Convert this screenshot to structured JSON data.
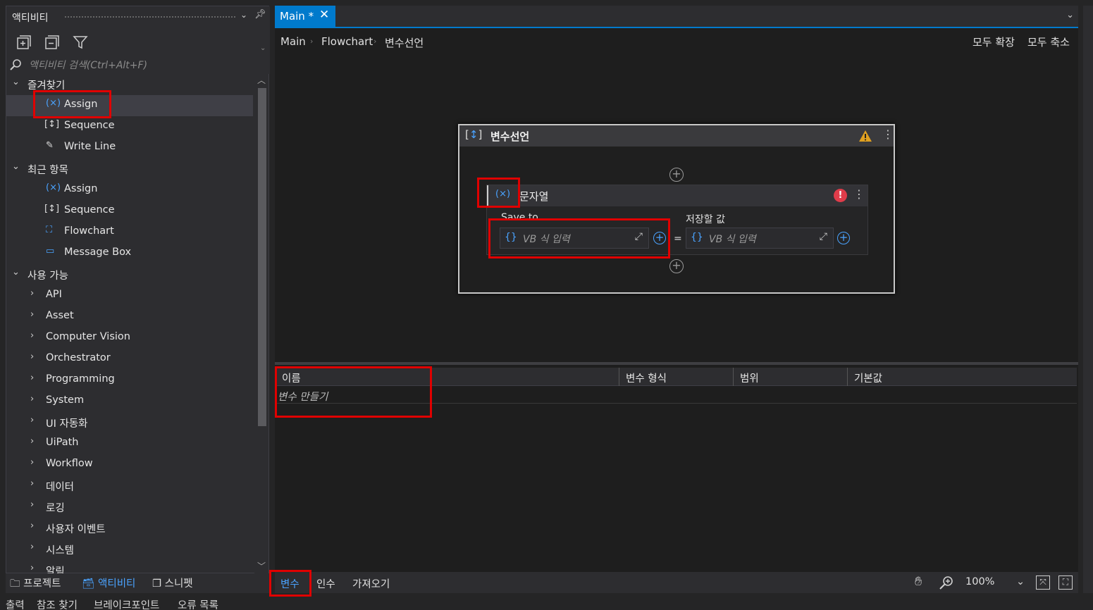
{
  "activities_panel": {
    "title": "액티비티",
    "search_placeholder": "액티비티 검색(Ctrl+Alt+F)",
    "favorites": {
      "label": "즐겨찾기",
      "items": [
        {
          "label": "Assign",
          "icon": "(×)"
        },
        {
          "label": "Sequence",
          "icon": "[↕]"
        },
        {
          "label": "Write Line",
          "icon": "✎"
        }
      ]
    },
    "recent": {
      "label": "최근 항목",
      "items": [
        {
          "label": "Assign",
          "icon": "(×)"
        },
        {
          "label": "Sequence",
          "icon": "[↕]"
        },
        {
          "label": "Flowchart",
          "icon": "⛶"
        },
        {
          "label": "Message Box",
          "icon": "▭"
        }
      ]
    },
    "available": {
      "label": "사용 가능",
      "items": [
        "API",
        "Asset",
        "Computer Vision",
        "Orchestrator",
        "Programming",
        "System",
        "UI 자동화",
        "UiPath",
        "Workflow",
        "데이터",
        "로깅",
        "사용자 이벤트",
        "시스템",
        "알림"
      ]
    }
  },
  "left_tabs": [
    "프로젝트",
    "액티비티",
    "스니펫"
  ],
  "bottom_tabs": [
    "출력",
    "참조 찾기",
    "브레이크포인트",
    "오류 목록"
  ],
  "document": {
    "tab_title": "Main *",
    "breadcrumb": [
      "Main",
      "Flowchart",
      "변수선언"
    ],
    "expand_all": "모두 확장",
    "collapse_all": "모두 축소",
    "sequence_title": "변수선언",
    "assign_title": "문자열",
    "save_to_label": "Save to",
    "value_label": "저장할 값",
    "vb_placeholder_left": "VB 식 입력",
    "vb_placeholder_right": "VB 식 입력",
    "equals": "="
  },
  "variables_grid": {
    "columns": [
      "이름",
      "변수 형식",
      "범위",
      "기본값"
    ],
    "new_row_text": "변수 만들기"
  },
  "designer_bar": {
    "tabs": [
      "변수",
      "인수",
      "가져오기"
    ],
    "zoom": "100%"
  },
  "colors": {
    "accent": "#007acc",
    "highlight_box": "#e00000",
    "warning": "#e0a020",
    "error": "#e03c4a"
  }
}
